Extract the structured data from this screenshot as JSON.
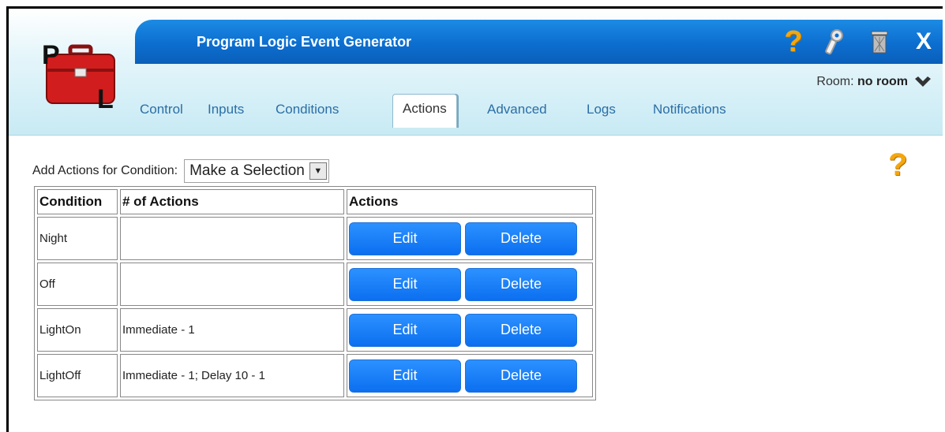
{
  "app": {
    "title": "Program Logic Event Generator",
    "logo_letters": "PL",
    "brand_colors": {
      "title_bar": "#0c6ed0",
      "logo": "#d11d1d",
      "help": "#f3a70f",
      "button": "#1176f4"
    }
  },
  "toolbar": {
    "help_glyph": "?",
    "close_glyph": "X",
    "icons": [
      "help-icon",
      "settings-icon",
      "trash-icon",
      "close-icon"
    ]
  },
  "room": {
    "label": "Room:",
    "value": "no room"
  },
  "tabs": [
    {
      "label": "Control"
    },
    {
      "label": "Inputs"
    },
    {
      "label": "Conditions"
    },
    {
      "label": "Actions",
      "active": true
    },
    {
      "label": "Advanced"
    },
    {
      "label": "Logs"
    },
    {
      "label": "Notifications"
    }
  ],
  "main": {
    "help_glyph": "?",
    "add_label": "Add Actions for Condition:",
    "select_value": "Make a Selection"
  },
  "table": {
    "headers": [
      "Condition",
      "# of Actions",
      "Actions"
    ],
    "rows": [
      {
        "condition": "Night",
        "count": "",
        "edit": "Edit",
        "delete": "Delete"
      },
      {
        "condition": "Off",
        "count": "",
        "edit": "Edit",
        "delete": "Delete"
      },
      {
        "condition": "LightOn",
        "count": "Immediate - 1",
        "edit": "Edit",
        "delete": "Delete"
      },
      {
        "condition": "LightOff",
        "count": "Immediate - 1; Delay 10 - 1",
        "edit": "Edit",
        "delete": "Delete"
      }
    ]
  }
}
